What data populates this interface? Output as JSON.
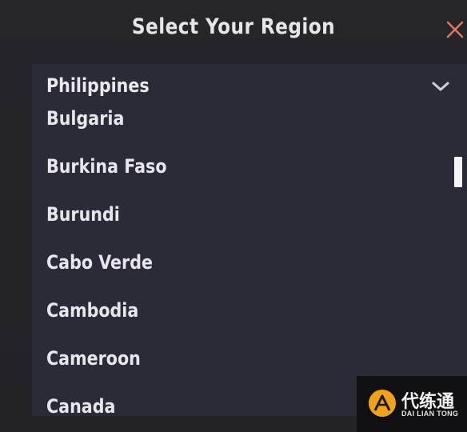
{
  "dialog": {
    "title": "Select Your Region",
    "close_icon": "close-icon",
    "accent_color": "#e0755a"
  },
  "region_select": {
    "selected_value": "Philippines",
    "dropdown_icon": "chevron-down-icon",
    "options": [
      "Bulgaria",
      "Burkina Faso",
      "Burundi",
      "Cabo Verde",
      "Cambodia",
      "Cameroon",
      "Canada"
    ]
  },
  "watermark": {
    "name_cn": "代练通",
    "name_en": "DAI LIAN TONG",
    "logo_icon": "dailiantong-logo-icon"
  }
}
